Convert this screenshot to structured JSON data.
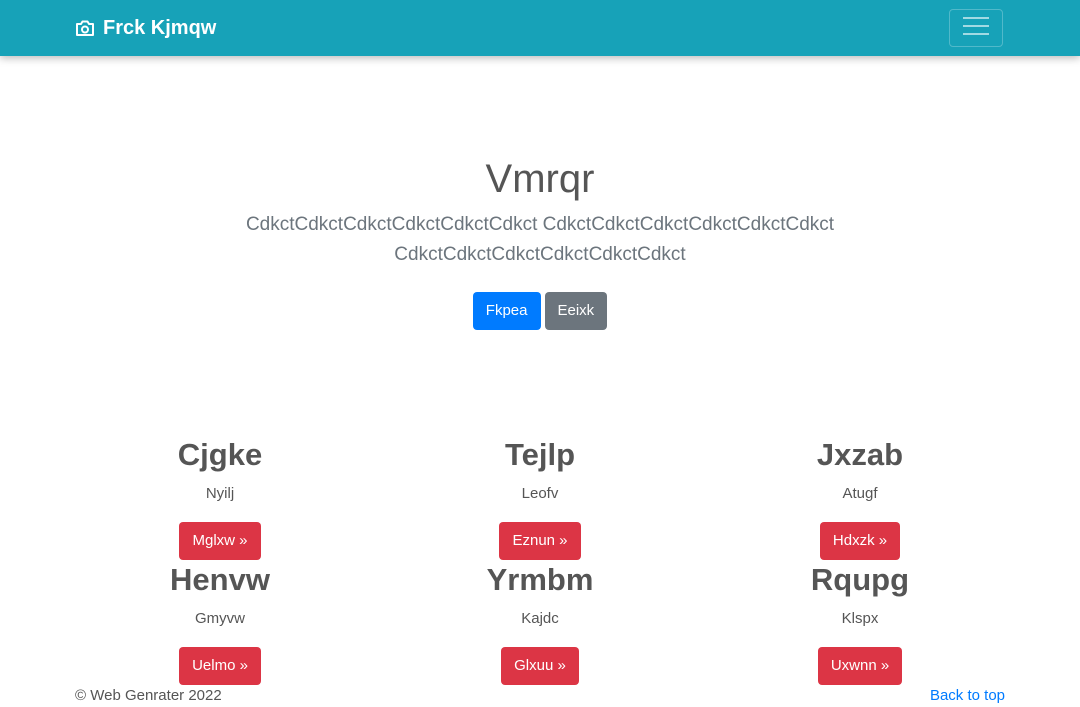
{
  "navbar": {
    "brand_icon": "camera-icon",
    "brand": "Frck Kjmqw",
    "toggler_icon": "hamburger-icon",
    "background": "#17a2b8"
  },
  "hero": {
    "title": "Vmrqr",
    "lead": "CdkctCdkctCdkctCdkctCdkctCdkct CdkctCdkctCdkctCdkctCdkctCdkct CdkctCdkctCdkctCdkctCdkctCdkct",
    "primary_button": "Fkpea",
    "secondary_button": "Eeixk"
  },
  "cards": [
    {
      "title": "Cjgke",
      "text": "Nyilj",
      "button": "Mglxw »"
    },
    {
      "title": "Tejlp",
      "text": "Leofv",
      "button": "Eznun »"
    },
    {
      "title": "Jxzab",
      "text": "Atugf",
      "button": "Hdxzk »"
    },
    {
      "title": "Henvw",
      "text": "Gmyvw",
      "button": "Uelmo »"
    },
    {
      "title": "Yrmbm",
      "text": "Kajdc",
      "button": "Glxuu »"
    },
    {
      "title": "Rqupg",
      "text": "Klspx",
      "button": "Uxwnn »"
    }
  ],
  "footer": {
    "copyright": "© Web Genrater 2022",
    "back_to_top": "Back to top"
  },
  "colors": {
    "primary": "#007bff",
    "secondary": "#6c757d",
    "danger": "#dc3545"
  }
}
